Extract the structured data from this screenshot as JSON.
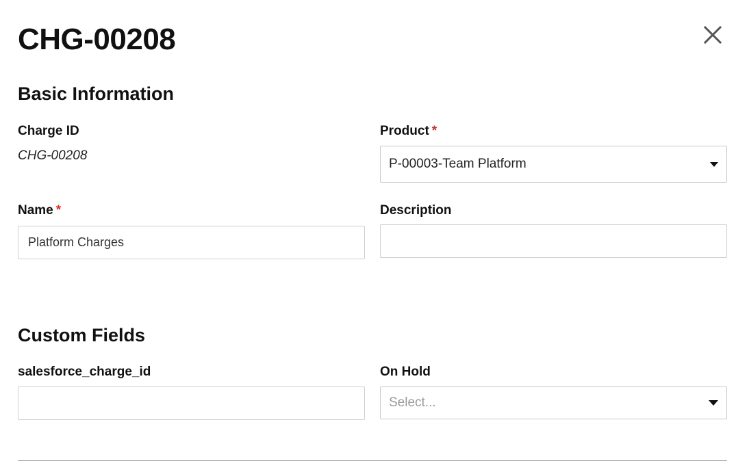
{
  "modal": {
    "title": "CHG-00208"
  },
  "basic_info": {
    "heading": "Basic Information",
    "charge_id": {
      "label": "Charge ID",
      "value": "CHG-00208"
    },
    "product": {
      "label": "Product",
      "required_mark": "*",
      "selected": "P-00003-Team Platform"
    },
    "name": {
      "label": "Name",
      "required_mark": "*",
      "value": "Platform Charges"
    },
    "description": {
      "label": "Description",
      "value": ""
    }
  },
  "custom_fields": {
    "heading": "Custom Fields",
    "salesforce_charge_id": {
      "label": "salesforce_charge_id",
      "value": ""
    },
    "on_hold": {
      "label": "On Hold",
      "placeholder": "Select..."
    }
  },
  "icons": {
    "close": "close-icon",
    "caret": "chevron-down-icon"
  },
  "colors": {
    "required": "#d22f27",
    "border": "#cfcfcf",
    "placeholder": "#9a9a9a"
  }
}
